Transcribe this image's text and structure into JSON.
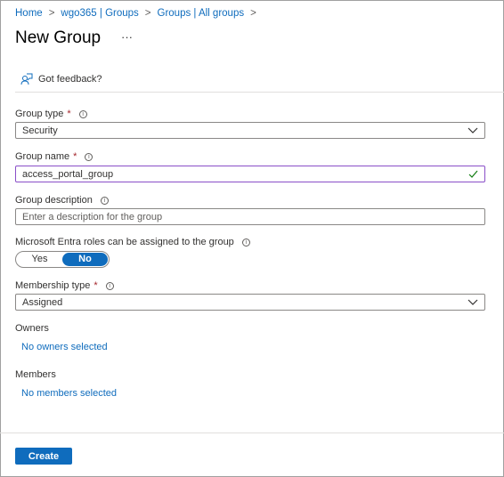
{
  "breadcrumb": [
    "Home",
    "wgo365 | Groups",
    "Groups | All groups"
  ],
  "page": {
    "title": "New Group",
    "more": "···"
  },
  "feedback": "Got feedback?",
  "form": {
    "group_type": {
      "label": "Group type",
      "value": "Security"
    },
    "group_name": {
      "label": "Group name",
      "value": "access_portal_group"
    },
    "group_description": {
      "label": "Group description",
      "placeholder": "Enter a description for the group"
    },
    "entra_roles": {
      "label": "Microsoft Entra roles can be assigned to the group",
      "options": [
        "Yes",
        "No"
      ],
      "selected": "No"
    },
    "membership_type": {
      "label": "Membership type",
      "value": "Assigned"
    },
    "owners": {
      "label": "Owners",
      "link": "No owners selected"
    },
    "members": {
      "label": "Members",
      "link": "No members selected"
    },
    "required_mark": "*",
    "info": "i"
  },
  "actions": {
    "create": "Create"
  },
  "colors": {
    "accent": "#0f6cbd",
    "required": "#a4262c",
    "valid_border": "#8a4fc8"
  }
}
